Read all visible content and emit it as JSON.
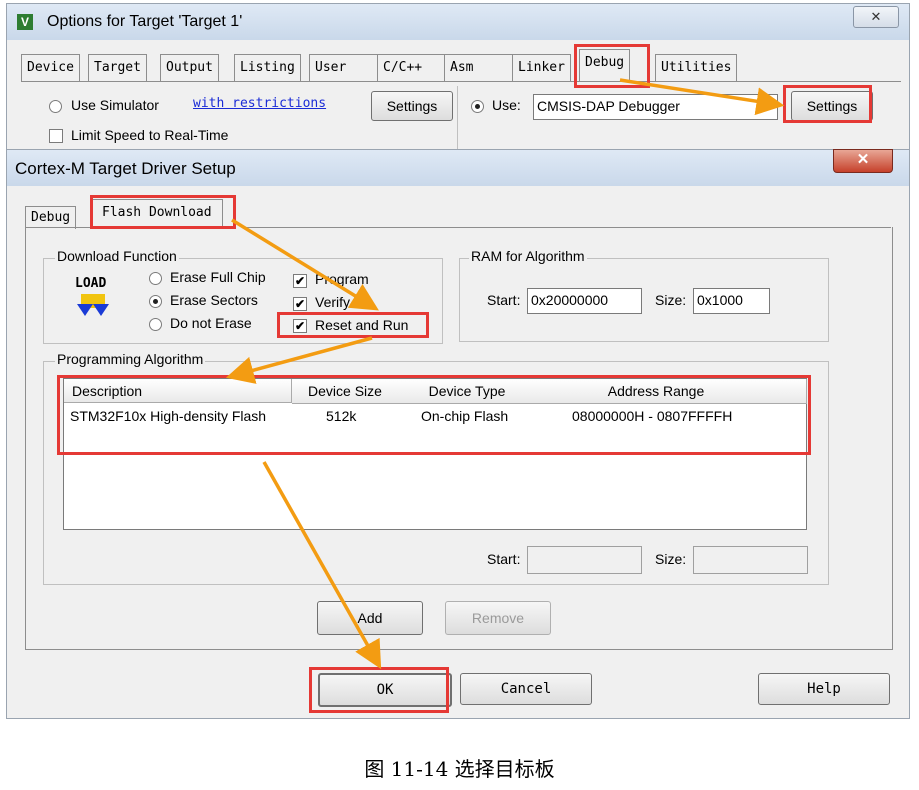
{
  "outer": {
    "title": "Options for Target 'Target 1'",
    "close_glyph": "✕",
    "tabs": [
      "Device",
      "Target",
      "Output",
      "Listing",
      "User",
      "C/C++",
      "Asm",
      "Linker",
      "Debug",
      "Utilities"
    ],
    "active_tab": "Debug",
    "use_simulator_label": "Use Simulator",
    "with_restrictions_link": "with restrictions",
    "left_settings_label": "Settings",
    "limit_speed_label": "Limit Speed to Real-Time",
    "use_label": "Use:",
    "debugger_value": "CMSIS-DAP Debugger",
    "right_settings_label": "Settings"
  },
  "inner": {
    "title": "Cortex-M Target Driver Setup",
    "close_glyph": "✕",
    "tabs": [
      "Debug",
      "Flash Download"
    ],
    "active_tab": "Flash Download",
    "download_function": {
      "title": "Download Function",
      "load_icon_text": "LOAD",
      "erase_full_chip": "Erase Full Chip",
      "erase_sectors": "Erase Sectors",
      "do_not_erase": "Do not Erase",
      "program": "Program",
      "verify": "Verify",
      "reset_and_run": "Reset and Run",
      "selected_erase": "Erase Sectors",
      "program_checked": true,
      "verify_checked": true,
      "reset_and_run_checked": true
    },
    "ram_for_algorithm": {
      "title": "RAM for Algorithm",
      "start_label": "Start:",
      "start_value": "0x20000000",
      "size_label": "Size:",
      "size_value": "0x1000"
    },
    "programming_algorithm": {
      "title": "Programming Algorithm",
      "columns": [
        "Description",
        "Device Size",
        "Device Type",
        "Address Range"
      ],
      "rows": [
        {
          "description": "STM32F10x High-density Flash",
          "device_size": "512k",
          "device_type": "On-chip Flash",
          "address_range": "08000000H - 0807FFFFH"
        }
      ],
      "start_label": "Start:",
      "size_label": "Size:",
      "add_label": "Add",
      "remove_label": "Remove"
    },
    "ok_label": "OK",
    "cancel_label": "Cancel",
    "help_label": "Help"
  },
  "caption": "图 11-14 选择目标板",
  "colors": {
    "highlight": "#e53935",
    "arrow": "#f39c12",
    "window_bg": "#f0f0f0",
    "title_bar": "#dfe9f5"
  }
}
